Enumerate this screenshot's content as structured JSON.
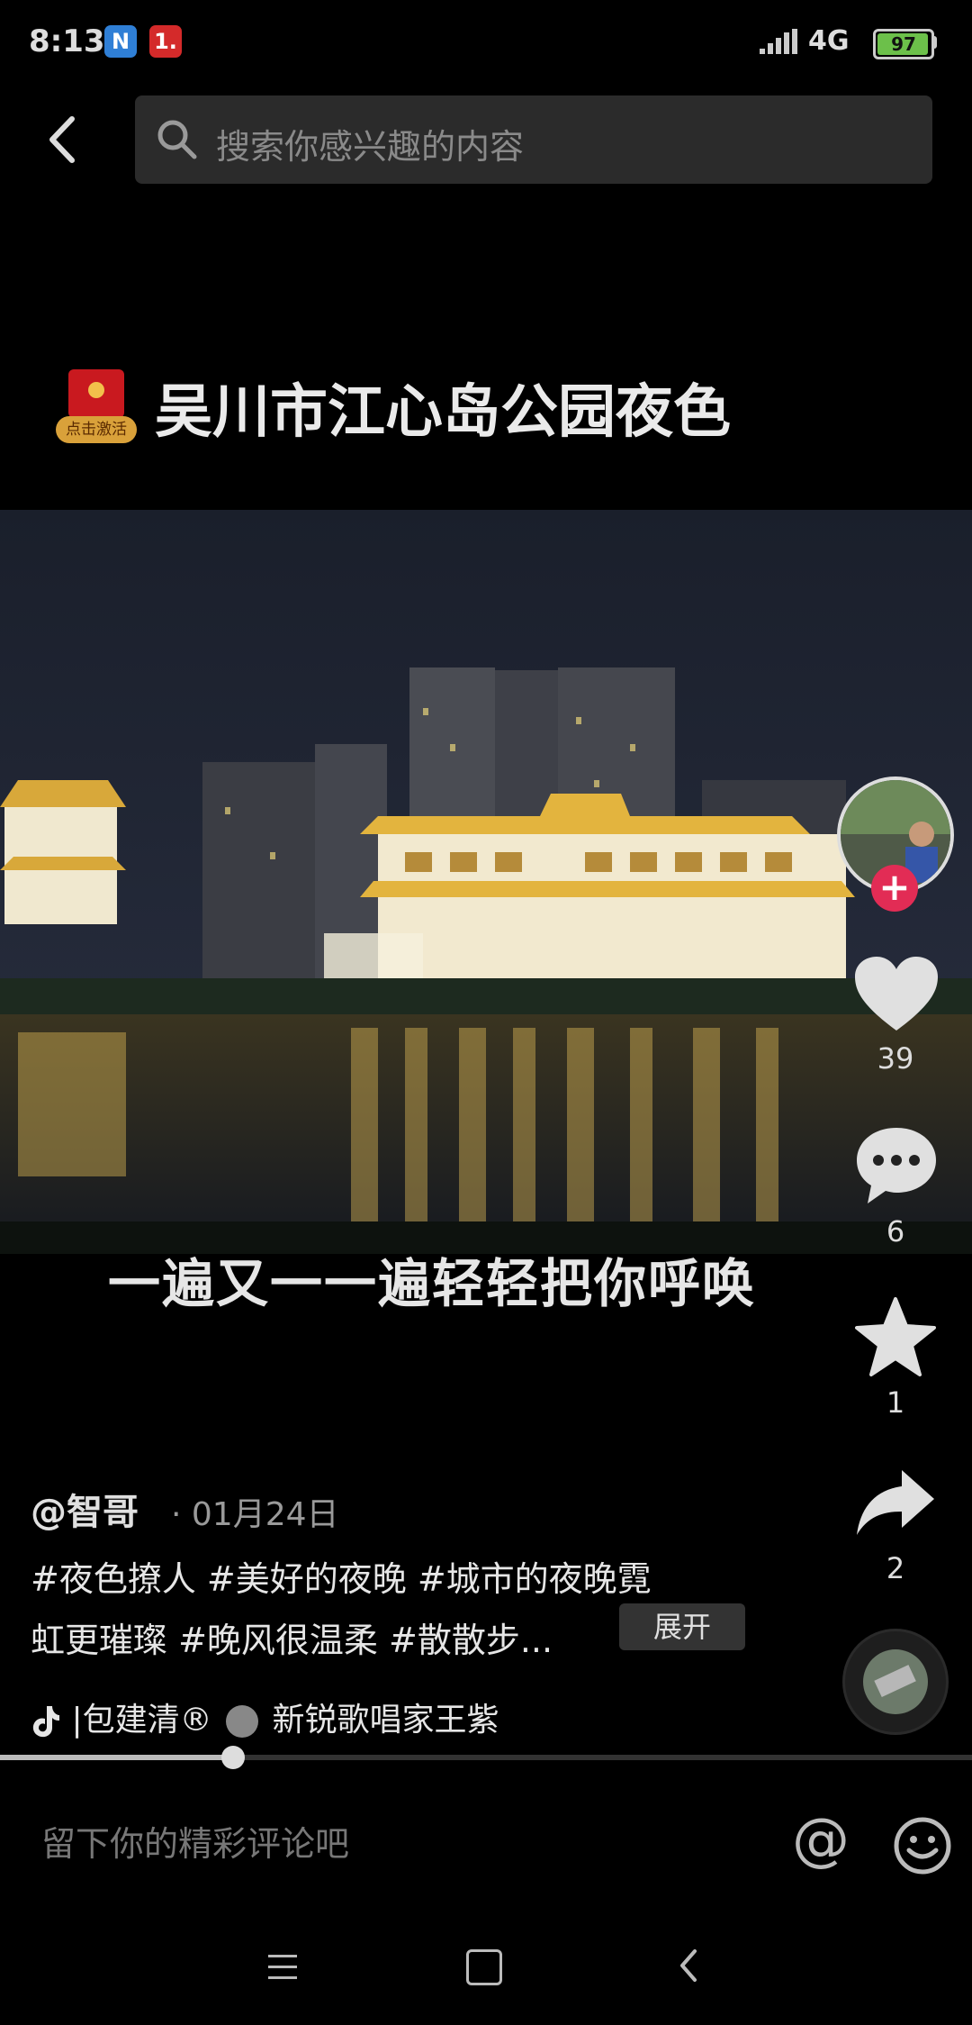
{
  "status_bar": {
    "time": "8:13",
    "notif_1": "N",
    "notif_2": "1.",
    "network": "4G",
    "battery": "97",
    "battery_level": 0.97
  },
  "search": {
    "placeholder": "搜索你感兴趣的内容"
  },
  "video": {
    "redpack_label": "点击激活",
    "title": "吴川市江心岛公园夜色",
    "subtitle": "一遍又一一遍轻轻把你呼唤",
    "progress": 0.24
  },
  "actions": {
    "likes": "39",
    "comments": "6",
    "favorites": "1",
    "shares": "2"
  },
  "info": {
    "author": "@智哥",
    "date": "· 01月24日",
    "desc_line1": "#夜色撩人 #美好的夜晚 #城市的夜晚霓",
    "desc_line2": "虹更璀璨 #晚风很温柔 #散散步...",
    "expand": "展开",
    "music_prefix": "|包建清®",
    "music_suffix": "新锐歌唱家王紫"
  },
  "comment_bar": {
    "placeholder": "留下你的精彩评论吧",
    "at": "@"
  },
  "colors": {
    "accent": "#e22c55",
    "background": "#000000"
  }
}
